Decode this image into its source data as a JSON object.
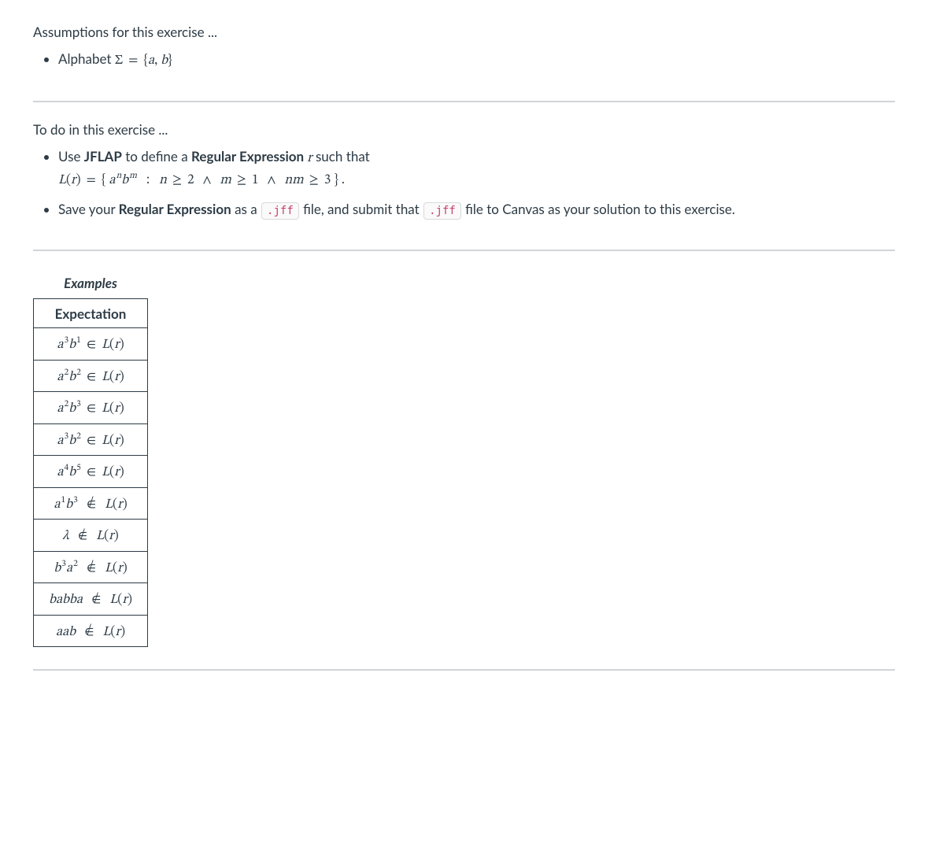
{
  "assumptions": {
    "heading": "Assumptions for this exercise ...",
    "alphabet_label": "Alphabet",
    "sigma": "Σ",
    "eq": "=",
    "set_open": "{",
    "set_a": "a",
    "set_comma": ",",
    "set_b": "b",
    "set_close": "}"
  },
  "todo": {
    "heading": "To do in this exercise ...",
    "item1_prefix": "Use ",
    "item1_jflap": "JFLAP",
    "item1_mid": " to define a ",
    "item1_regex": "Regular Expression",
    "item1_var_r": " r",
    "item1_suffix": " such that",
    "lang_def": {
      "L": "L",
      "r": "r",
      "eq": "=",
      "set_open": "{",
      "a": "a",
      "n": "n",
      "b": "b",
      "m": "m",
      "colon": ":",
      "ge": "≥",
      "c2": "2",
      "and": "∧",
      "c1": "1",
      "nm": "nm",
      "c3": "3",
      "set_close": "}",
      "period": "."
    },
    "item2_prefix": "Save your ",
    "item2_regex": "Regular Expression",
    "item2_mid1": " as a ",
    "jff": ".jff",
    "item2_mid2": " file, and submit that ",
    "item2_suffix": " file to Canvas as your solution to this exercise."
  },
  "table": {
    "caption": "Examples",
    "header": "Expectation",
    "L": "L",
    "r": "r",
    "in": "∈",
    "notin_base": "∈",
    "notin_slash": "/",
    "a": "a",
    "b": "b",
    "lambda": "λ",
    "babba": "babba",
    "aab": "aab",
    "rows": [
      {
        "lhs_type": "ab",
        "a_exp": "3",
        "b_exp": "1",
        "member": true
      },
      {
        "lhs_type": "ab",
        "a_exp": "2",
        "b_exp": "2",
        "member": true
      },
      {
        "lhs_type": "ab",
        "a_exp": "2",
        "b_exp": "3",
        "member": true
      },
      {
        "lhs_type": "ab",
        "a_exp": "3",
        "b_exp": "2",
        "member": true
      },
      {
        "lhs_type": "ab",
        "a_exp": "4",
        "b_exp": "5",
        "member": true
      },
      {
        "lhs_type": "ab",
        "a_exp": "1",
        "b_exp": "3",
        "member": false
      },
      {
        "lhs_type": "lambda",
        "member": false
      },
      {
        "lhs_type": "ba",
        "b_exp": "3",
        "a_exp": "2",
        "member": false
      },
      {
        "lhs_type": "word",
        "word_key": "babba",
        "member": false
      },
      {
        "lhs_type": "word",
        "word_key": "aab",
        "member": false
      }
    ]
  }
}
